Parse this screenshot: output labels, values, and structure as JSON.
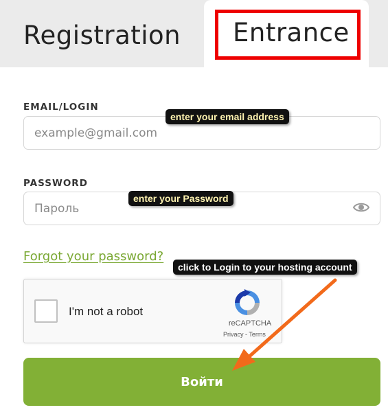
{
  "tabs": {
    "registration": "Registration",
    "entrance": "Entrance"
  },
  "form": {
    "email_label": "EMAIL/LOGIN",
    "email_placeholder": "example@gmail.com",
    "password_label": "PASSWORD",
    "password_placeholder": "Пароль",
    "forgot_link": "Forgot your password?",
    "submit_label": "Войти"
  },
  "captcha": {
    "label": "I'm not a robot",
    "brand": "reCAPTCHA",
    "links": "Privacy - Terms"
  },
  "annotations": {
    "email_hint": "enter your email address",
    "password_hint": "enter your Password",
    "login_hint": "click to Login to your hosting account"
  },
  "colors": {
    "accent_green": "#82b036",
    "link_green": "#7aa833",
    "highlight_red": "#ee0000",
    "arrow_orange": "#f26a1b"
  },
  "icons": {
    "password_toggle": "eye-icon",
    "captcha_logo": "recaptcha-logo-icon"
  }
}
